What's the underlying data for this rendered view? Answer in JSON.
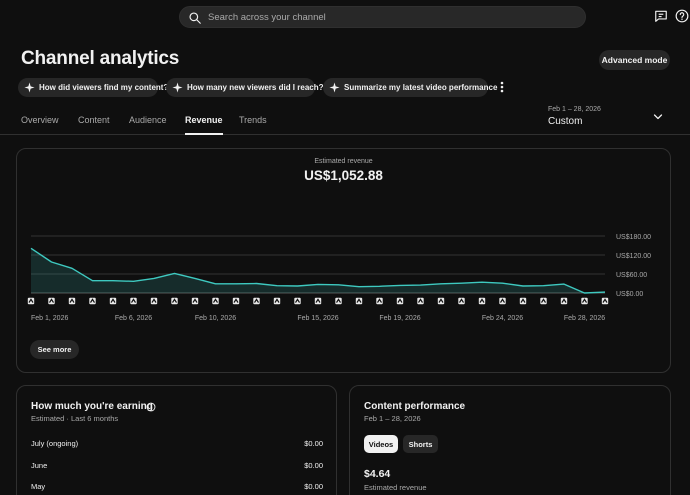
{
  "search": {
    "placeholder": "Search across your channel"
  },
  "header": {
    "title": "Channel analytics",
    "advanced_label": "Advanced mode"
  },
  "chips": [
    {
      "label": "How did viewers find my content?"
    },
    {
      "label": "How many new viewers did I reach?"
    },
    {
      "label": "Summarize my latest video performance"
    }
  ],
  "tabs": [
    {
      "label": "Overview"
    },
    {
      "label": "Content"
    },
    {
      "label": "Audience"
    },
    {
      "label": "Revenue",
      "active": true
    },
    {
      "label": "Trends"
    }
  ],
  "date_range": {
    "range": "Feb 1 – 28, 2026",
    "label": "Custom"
  },
  "revenue_card": {
    "metric_label": "Estimated revenue",
    "metric_value": "US$1,052.88",
    "see_more": "See more"
  },
  "chart_data": {
    "type": "area",
    "series": [
      {
        "values": [
          141,
          98,
          78,
          39,
          39,
          37,
          46,
          62,
          46,
          29,
          29,
          30,
          23,
          22,
          27,
          26,
          20,
          21,
          24,
          25,
          29,
          31,
          34,
          31,
          22,
          23,
          28,
          0,
          3
        ]
      }
    ],
    "x": [
      "Feb 1, 2026",
      "Feb 2, 2026",
      "Feb 3, 2026",
      "Feb 4, 2026",
      "Feb 5, 2026",
      "Feb 6, 2026",
      "Feb 7, 2026",
      "Feb 8, 2026",
      "Feb 9, 2026",
      "Feb 10, 2026",
      "Feb 11, 2026",
      "Feb 12, 2026",
      "Feb 13, 2026",
      "Feb 14, 2026",
      "Feb 15, 2026",
      "Feb 16, 2026",
      "Feb 17, 2026",
      "Feb 18, 2026",
      "Feb 19, 2026",
      "Feb 20, 2026",
      "Feb 21, 2026",
      "Feb 22, 2026",
      "Feb 23, 2026",
      "Feb 24, 2026",
      "Feb 25, 2026",
      "Feb 26, 2026",
      "Feb 27, 2026",
      "Feb 28, 2026",
      "Mar 1, 2026"
    ],
    "x_tick_labels": [
      "Feb 1, 2026",
      "Feb 6, 2026",
      "Feb 10, 2026",
      "Feb 15, 2026",
      "Feb 19, 2026",
      "Feb 24, 2026",
      "Feb 28, 2026"
    ],
    "y_tick_labels": [
      "US$0.00",
      "US$60.00",
      "US$120.00",
      "US$180.00"
    ],
    "ylim": [
      0,
      180
    ],
    "grid": true,
    "color": "#3ec9c0"
  },
  "earnings": {
    "title": "How much you're earning",
    "subtitle": "Estimated · Last 6 months",
    "rows": [
      {
        "month": "July (ongoing)",
        "value": "$0.00"
      },
      {
        "month": "June",
        "value": "$0.00"
      },
      {
        "month": "May",
        "value": "$0.00"
      }
    ]
  },
  "content_performance": {
    "title": "Content performance",
    "subtitle": "Feb 1 – 28, 2026",
    "tab_videos": "Videos",
    "tab_shorts": "Shorts",
    "value": "$4.64",
    "value_label": "Estimated revenue"
  },
  "colors": {
    "background": "#0f0f0f",
    "surface": "#272727",
    "accent": "#3ec9c0"
  }
}
